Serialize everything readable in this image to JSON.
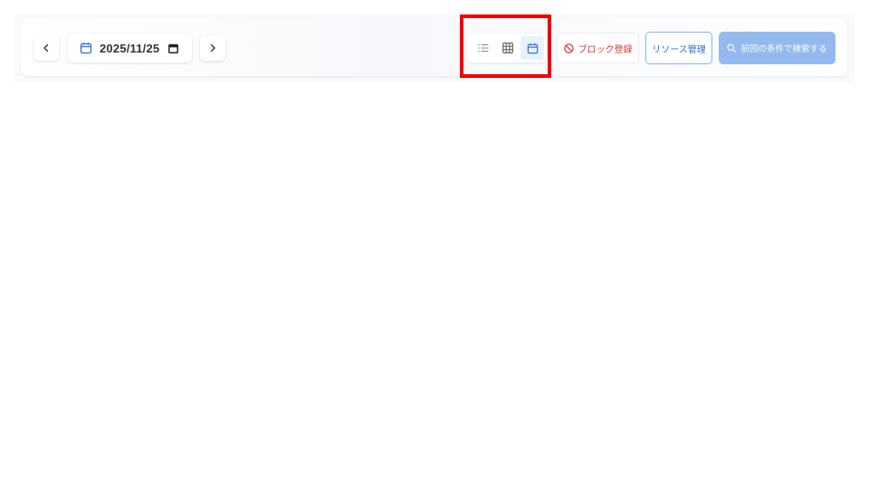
{
  "toolbar": {
    "prev_label": "‹",
    "next_label": "›",
    "date_value": "2025/11/25",
    "view_modes": [
      {
        "name": "list",
        "icon": "list-icon",
        "active": false
      },
      {
        "name": "grid",
        "icon": "grid-icon",
        "active": false
      },
      {
        "name": "calendar",
        "icon": "calendar-icon",
        "active": true
      }
    ],
    "block_label": "ブロック登録",
    "resource_label": "リソース管理",
    "search_label": "前回の条件で検索する"
  },
  "colors": {
    "accent": "#2f6fd8",
    "danger": "#e03131",
    "search_bg": "#94b9ef",
    "highlight": "#f00000",
    "active_view_bg": "#e8f1fd"
  }
}
